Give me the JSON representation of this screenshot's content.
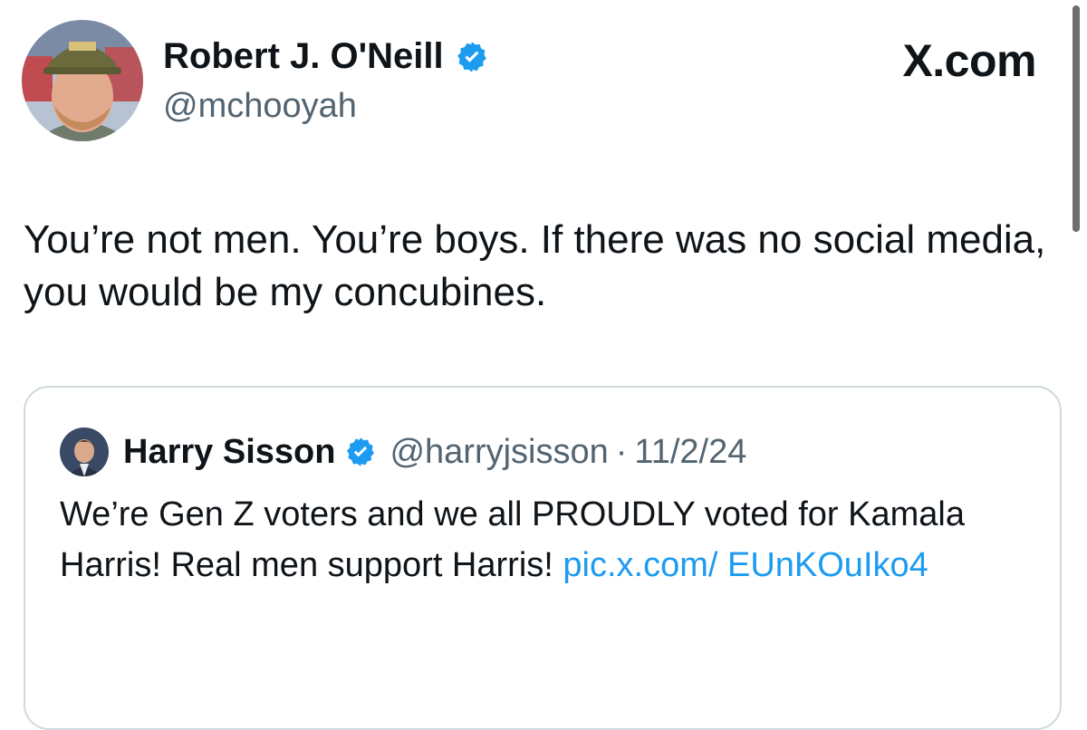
{
  "post": {
    "author_name": "Robert J. O'Neill",
    "author_handle": "@mchooyah",
    "site_mark": "X.com",
    "text": "You’re not men. You’re boys. If there was no social media, you would be my concubines."
  },
  "quote": {
    "author_name": "Harry Sisson",
    "author_handle": "@harryjsisson",
    "separator": "·",
    "date": "11/2/24",
    "text": "We’re Gen Z voters and we all PROUDLY voted for Kamala Harris! Real men support Harris! ",
    "link": "pic.x.com/ EUnKOuIko4"
  },
  "colors": {
    "verified_badge": "#1d9bf0",
    "link": "#1d9bf0",
    "secondary_text": "#536471"
  }
}
